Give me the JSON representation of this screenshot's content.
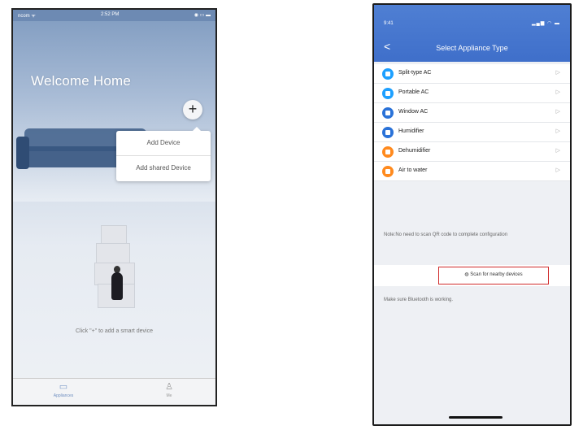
{
  "phone1": {
    "status": {
      "left": "ncom ᯤ",
      "center": "2:52 PM",
      "right": "◉ ▭ ▬"
    },
    "title": "Welcome Home",
    "plus_symbol": "+",
    "menu": [
      "Add Device",
      "Add shared Device"
    ],
    "hint": "Click \"+\" to add a smart device",
    "tabs": [
      {
        "icon": "▭",
        "label": "Appliances"
      },
      {
        "icon": "♙",
        "label": "Me"
      }
    ]
  },
  "phone2": {
    "time": "9:41",
    "signal": "▂▄▆ ◠ ▬",
    "back": "<",
    "title": "Select Appliance Type",
    "appliances": [
      {
        "label": "Split-type AC",
        "color": "#1ea0ff"
      },
      {
        "label": "Portable AC",
        "color": "#1ea0ff"
      },
      {
        "label": "Window AC",
        "color": "#2a72d8"
      },
      {
        "label": "Humidifier",
        "color": "#2a72d8"
      },
      {
        "label": "Dehumidifier",
        "color": "#ff8a1e"
      },
      {
        "label": "Air to water",
        "color": "#ff8a1e"
      }
    ],
    "arrow": "▷",
    "note": "Note:No need to scan QR code to complete configuration",
    "scan": "◍ Scan for nearby devices",
    "bluetooth": "Make sure Bluetooth is working."
  }
}
